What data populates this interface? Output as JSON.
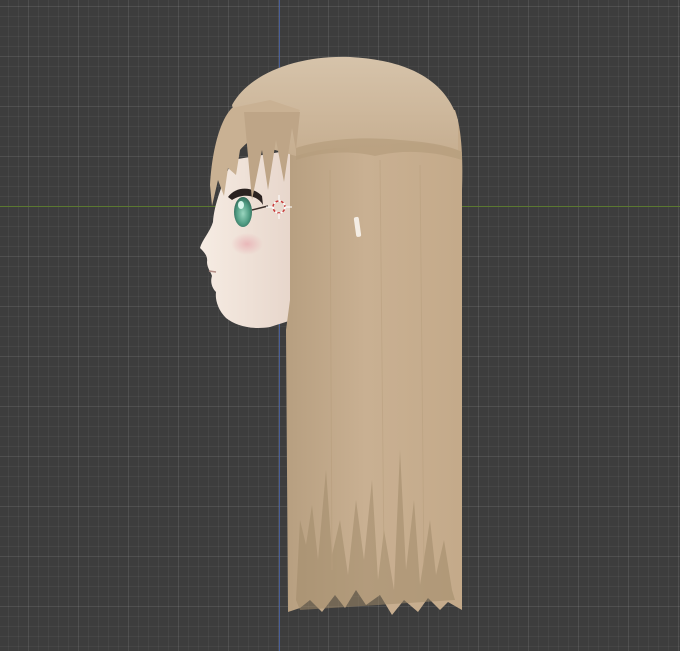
{
  "viewport": {
    "view": "side-orthographic",
    "background_color": "#3d3d3d",
    "grid_color": "#484848",
    "axis_colors": {
      "y_axis": "#5c7d2e",
      "z_axis": "#4a64a8"
    }
  },
  "model": {
    "name": "anime-character-head",
    "hair_color": "#c6ad8c",
    "hair_shadow_color": "#a18a6a",
    "skin_color": "#f1e6dd",
    "eye_color": "#4f9b82",
    "blush_color": "#e9b9bb"
  },
  "cursor": {
    "icon": "3d-cursor-icon"
  }
}
